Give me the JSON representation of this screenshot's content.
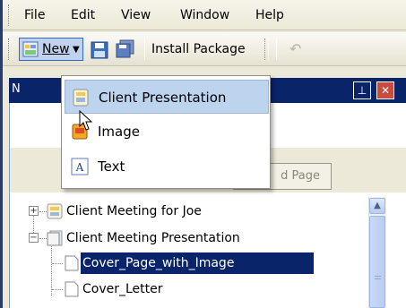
{
  "menubar": {
    "items": [
      "File",
      "Edit",
      "View",
      "Window",
      "Help"
    ]
  },
  "toolbar": {
    "new_label": "New",
    "install_package_label": "Install Package"
  },
  "panel": {
    "title_initial": "N",
    "tab_add_page": "d Page"
  },
  "dropdown": {
    "items": [
      {
        "label": "Client Presentation",
        "icon": "presentation-icon"
      },
      {
        "label": "Image",
        "icon": "image-icon"
      },
      {
        "label": "Text",
        "icon": "text-icon"
      }
    ]
  },
  "tree": {
    "rows": [
      {
        "label": "Client Meeting for Joe"
      },
      {
        "label": "Client Meeting Presentation"
      },
      {
        "label": "Cover_Page_with_Image",
        "selected": true
      },
      {
        "label": "Cover_Letter"
      }
    ]
  },
  "colors": {
    "selection": "#0a246a",
    "menu_hover": "#bcd4ee",
    "panel_header": "#0a246a"
  }
}
